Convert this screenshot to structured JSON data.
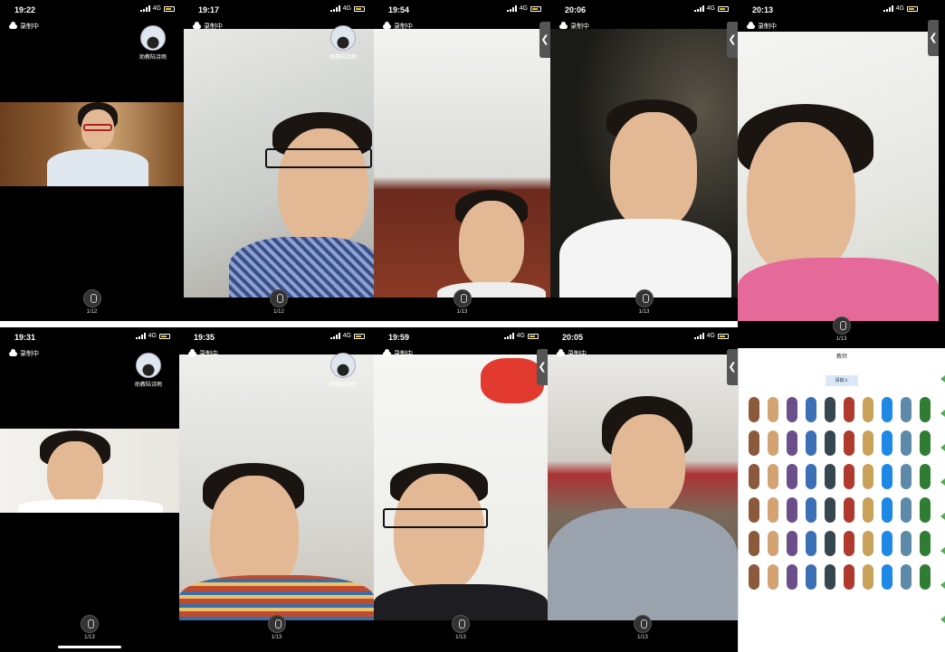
{
  "panels": [
    {
      "time": "19:22",
      "network": "4G",
      "recording": "录制中",
      "assistant": "助教陆诗雨",
      "page": "1/12"
    },
    {
      "time": "19:17",
      "network": "4G",
      "recording": "录制中",
      "assistant": "助教陆诗雨",
      "page": "1/12"
    },
    {
      "time": "19:54",
      "network": "4G",
      "recording": "录制中",
      "page": "1/13"
    },
    {
      "time": "20:06",
      "network": "4G",
      "recording": "录制中",
      "page": "1/13"
    },
    {
      "time": "20:13",
      "network": "4G",
      "recording": "录制中",
      "page": "1/13"
    },
    {
      "time": "19:31",
      "network": "4G",
      "recording": "录制中",
      "assistant": "助教陆诗雨",
      "page": "1/13"
    },
    {
      "time": "19:35",
      "network": "4G",
      "recording": "录制中",
      "assistant": "助教陆诗雨",
      "page": "1/13"
    },
    {
      "time": "19:59",
      "network": "4G",
      "recording": "录制中",
      "page": "1/13"
    },
    {
      "time": "20:05",
      "network": "4G",
      "recording": "录制中",
      "page": "1/13"
    }
  ],
  "side_tab_glyph": "❮",
  "roster": {
    "title": "教师",
    "search_label": "请输入"
  },
  "colors": {
    "panel_bg": "#000000",
    "battery": "#f0c419",
    "roster_accent": "#dbe9f6",
    "green_marker": "#4caf50"
  }
}
